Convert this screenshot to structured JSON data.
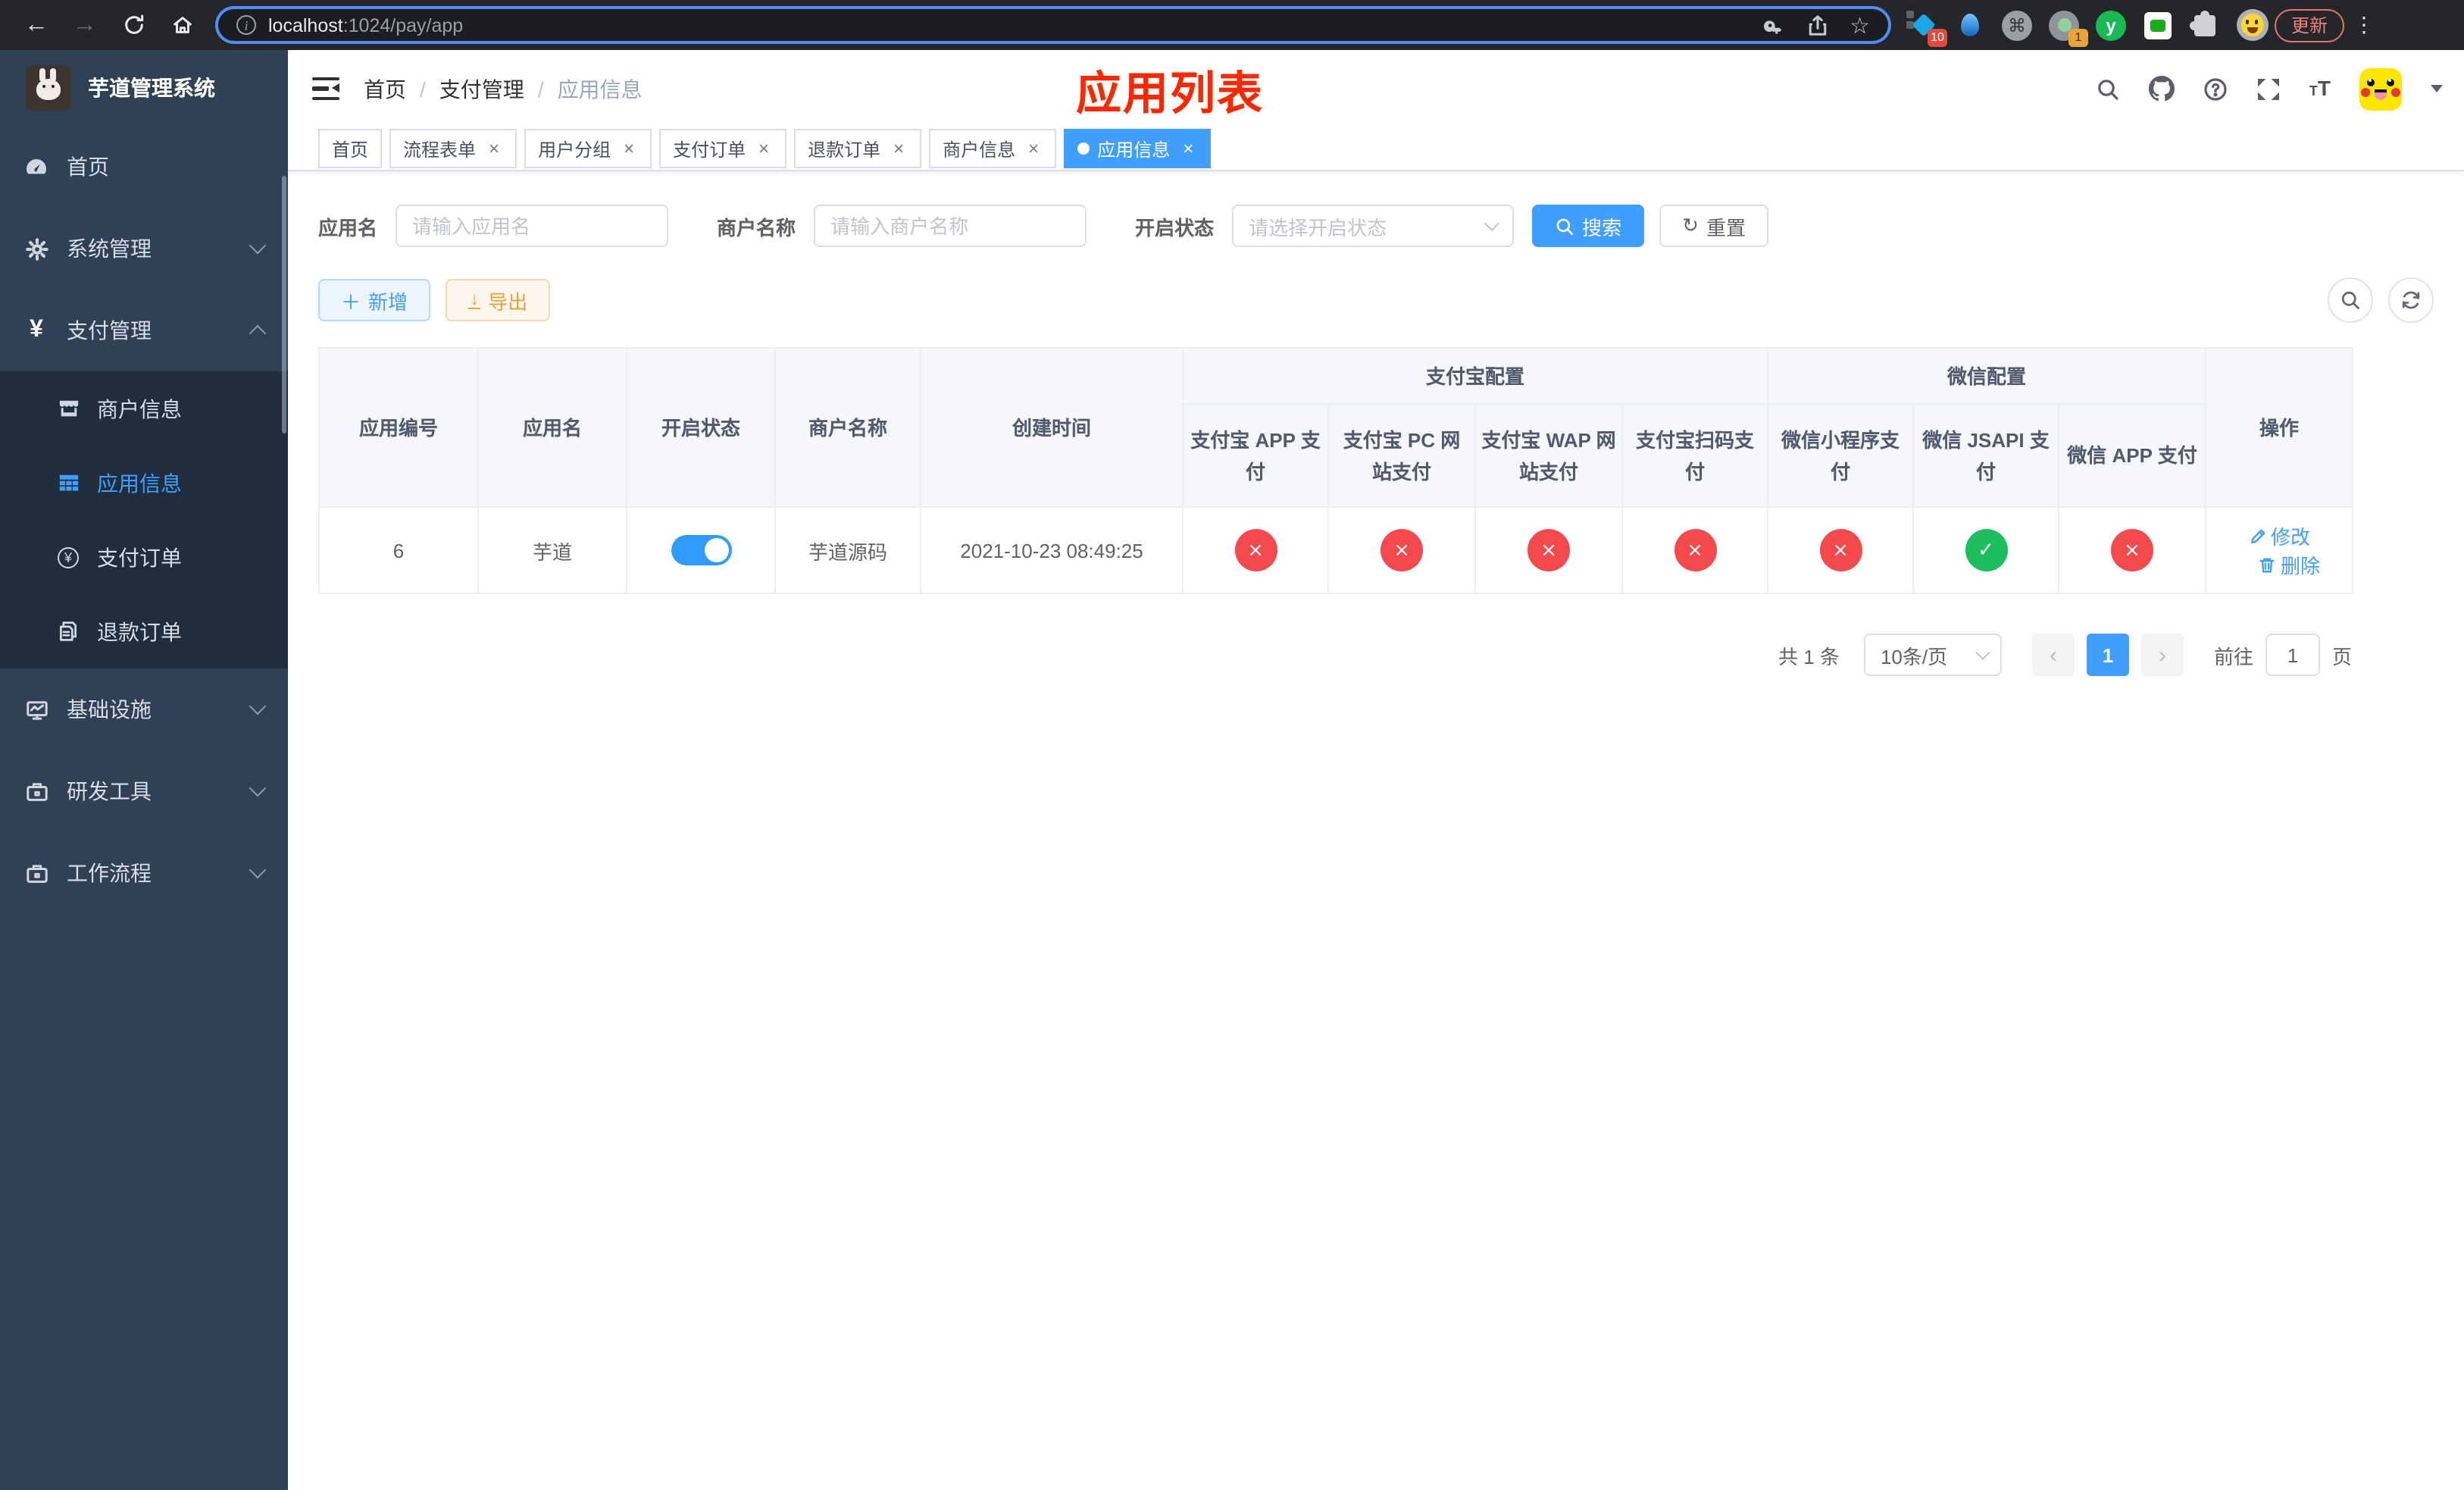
{
  "browser": {
    "url_host": "localhost",
    "url_path": ":1024/pay/app",
    "ext_badge_tabs": "10",
    "ext_badge_one": "1",
    "ext_y_letter": "y",
    "update_label": "更新"
  },
  "icons": {
    "back": "←",
    "forward": "→",
    "reload": "↻",
    "star": "☆",
    "command": "⌘",
    "more": "⋮",
    "info": "i",
    "plus": "＋",
    "download": "↓",
    "refresh": "↻",
    "close": "×",
    "check": "✓",
    "cross": "×",
    "prev": "‹",
    "next": "›",
    "tt_small": "T",
    "tt_big": "T",
    "question": "?",
    "yen": "¥"
  },
  "sidebar": {
    "title": "芋道管理系统",
    "items": [
      {
        "label": "首页"
      },
      {
        "label": "系统管理"
      },
      {
        "label": "支付管理"
      },
      {
        "label": "商户信息"
      },
      {
        "label": "应用信息"
      },
      {
        "label": "支付订单"
      },
      {
        "label": "退款订单"
      },
      {
        "label": "基础设施"
      },
      {
        "label": "研发工具"
      },
      {
        "label": "工作流程"
      }
    ]
  },
  "header": {
    "breadcrumb": [
      "首页",
      "支付管理",
      "应用信息"
    ],
    "separator": "/",
    "page_title": "应用列表"
  },
  "tabs": [
    {
      "label": "首页"
    },
    {
      "label": "流程表单"
    },
    {
      "label": "用户分组"
    },
    {
      "label": "支付订单"
    },
    {
      "label": "退款订单"
    },
    {
      "label": "商户信息"
    },
    {
      "label": "应用信息"
    }
  ],
  "filters": {
    "app_name_label": "应用名",
    "app_name_placeholder": "请输入应用名",
    "merchant_label": "商户名称",
    "merchant_placeholder": "请输入商户名称",
    "status_label": "开启状态",
    "status_placeholder": "请选择开启状态",
    "search_label": "搜索",
    "reset_label": "重置"
  },
  "toolbar": {
    "add_label": "新增",
    "export_label": "导出"
  },
  "table": {
    "col_id": "应用编号",
    "col_name": "应用名",
    "col_status": "开启状态",
    "col_merchant": "商户名称",
    "col_created": "创建时间",
    "group_alipay": "支付宝配置",
    "group_wechat": "微信配置",
    "col_actions": "操作",
    "sub_columns": [
      "支付宝 APP 支付",
      "支付宝 PC 网站支付",
      "支付宝 WAP 网站支付",
      "支付宝扫码支付",
      "微信小程序支付",
      "微信 JSAPI 支付",
      "微信 APP 支付"
    ],
    "row": {
      "id": "6",
      "name": "芋道",
      "enabled": true,
      "merchant": "芋道源码",
      "created": "2021-10-23 08:49:25",
      "statuses": [
        false,
        false,
        false,
        false,
        false,
        true,
        false
      ],
      "edit_label": "修改",
      "delete_label": "删除"
    }
  },
  "pagination": {
    "total_label": "共 1 条",
    "page_size": "10条/页",
    "current_page": "1",
    "goto_label": "前往",
    "goto_value": "1",
    "unit_label": "页"
  },
  "colors": {
    "accent": "#409EFF",
    "danger": "#f4494d",
    "success": "#1ebe5f",
    "title_red": "#fc2800",
    "sidebar_bg": "#304156",
    "submenu_bg": "#1f2d3d"
  }
}
